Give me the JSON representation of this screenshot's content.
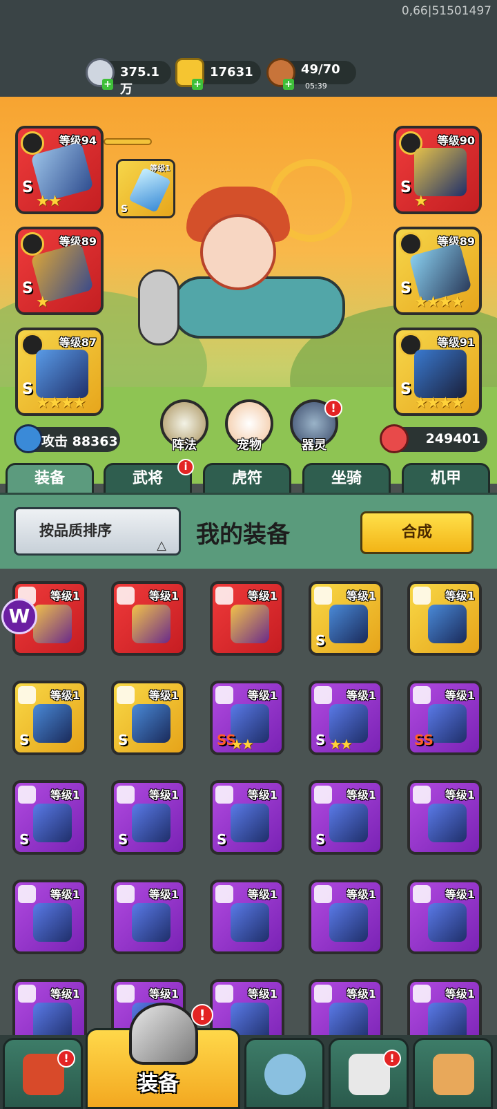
{
  "debug_id": "0,66|51501497",
  "resources": [
    {
      "value": "375.1万",
      "sub": "",
      "icon": "silver-coin-icon",
      "color": "#cfd6e0"
    },
    {
      "value": "17631",
      "sub": "",
      "icon": "gold-ingot-icon",
      "color": "#f5c531"
    },
    {
      "value": "49/70",
      "sub": "05:39",
      "icon": "meat-leg-icon",
      "color": "#c8743a"
    }
  ],
  "hero_slots": {
    "left": [
      {
        "level": "等级94",
        "grade": "S",
        "stars": "★★",
        "color": "red"
      },
      {
        "level": "等级89",
        "grade": "S",
        "stars": "★",
        "color": "red"
      },
      {
        "level": "等级87",
        "grade": "S",
        "stars": "★★★★",
        "color": "gold"
      }
    ],
    "right": [
      {
        "level": "等级90",
        "grade": "S",
        "stars": "★",
        "color": "red"
      },
      {
        "level": "等级89",
        "grade": "S",
        "stars": "★★★★",
        "color": "gold"
      },
      {
        "level": "等级91",
        "grade": "S",
        "stars": "★★★★",
        "color": "gold"
      }
    ],
    "linked": {
      "level": "等级1",
      "grade": "S"
    }
  },
  "round_buttons": [
    {
      "label": "阵法",
      "icon": "formation-icon",
      "badge": ""
    },
    {
      "label": "宠物",
      "icon": "pet-cat-icon",
      "badge": ""
    },
    {
      "label": "器灵",
      "icon": "weapon-spirit-icon",
      "badge": "!"
    }
  ],
  "stats": {
    "attack": "攻击 88363",
    "hp": "249401"
  },
  "tabs": [
    {
      "label": "装备",
      "active": true,
      "badge": ""
    },
    {
      "label": "武将",
      "active": false,
      "badge": "i"
    },
    {
      "label": "虎符",
      "active": false,
      "badge": ""
    },
    {
      "label": "坐骑",
      "active": false,
      "badge": ""
    },
    {
      "label": "机甲",
      "active": false,
      "badge": ""
    }
  ],
  "panel": {
    "sort_label": "按品质排序",
    "sort_arrow": "△",
    "title": "我的装备",
    "merge_label": "合成"
  },
  "inventory": [
    {
      "level": "等级1",
      "grade": "",
      "stars": "",
      "color": "red"
    },
    {
      "level": "等级1",
      "grade": "",
      "stars": "",
      "color": "red"
    },
    {
      "level": "等级1",
      "grade": "",
      "stars": "",
      "color": "red"
    },
    {
      "level": "等级1",
      "grade": "S",
      "stars": "",
      "color": "gold"
    },
    {
      "level": "等级1",
      "grade": "",
      "stars": "",
      "color": "gold"
    },
    {
      "level": "等级1",
      "grade": "S",
      "stars": "",
      "color": "gold"
    },
    {
      "level": "等级1",
      "grade": "S",
      "stars": "",
      "color": "gold"
    },
    {
      "level": "等级1",
      "grade": "SS",
      "stars": "★★",
      "color": "purple"
    },
    {
      "level": "等级1",
      "grade": "S",
      "stars": "★★",
      "color": "purple"
    },
    {
      "level": "等级1",
      "grade": "SS",
      "stars": "",
      "color": "purple"
    },
    {
      "level": "等级1",
      "grade": "S",
      "stars": "",
      "color": "purple"
    },
    {
      "level": "等级1",
      "grade": "S",
      "stars": "",
      "color": "purple"
    },
    {
      "level": "等级1",
      "grade": "S",
      "stars": "",
      "color": "purple"
    },
    {
      "level": "等级1",
      "grade": "S",
      "stars": "",
      "color": "purple"
    },
    {
      "level": "等级1",
      "grade": "",
      "stars": "",
      "color": "purple"
    },
    {
      "level": "等级1",
      "grade": "",
      "stars": "",
      "color": "purple"
    },
    {
      "level": "等级1",
      "grade": "",
      "stars": "",
      "color": "purple"
    },
    {
      "level": "等级1",
      "grade": "",
      "stars": "",
      "color": "purple"
    },
    {
      "level": "等级1",
      "grade": "",
      "stars": "",
      "color": "purple"
    },
    {
      "level": "等级1",
      "grade": "",
      "stars": "",
      "color": "purple"
    },
    {
      "level": "等级1",
      "grade": "",
      "stars": "",
      "color": "purple"
    },
    {
      "level": "等级1",
      "grade": "",
      "stars": "",
      "color": "purple"
    },
    {
      "level": "等级1",
      "grade": "",
      "stars": "",
      "color": "purple"
    },
    {
      "level": "等级1",
      "grade": "",
      "stars": "",
      "color": "purple"
    },
    {
      "level": "等级1",
      "grade": "",
      "stars": "",
      "color": "purple"
    }
  ],
  "bottom_nav": [
    {
      "label": "",
      "icon": "shop-gate-icon",
      "badge": "!"
    },
    {
      "label": "装备",
      "icon": "helmet-icon",
      "badge": "!"
    },
    {
      "label": "",
      "icon": "crossed-swords-icon",
      "badge": ""
    },
    {
      "label": "",
      "icon": "horn-rank-icon",
      "badge": "!"
    },
    {
      "label": "",
      "icon": "fist-upgrade-icon",
      "badge": ""
    }
  ]
}
